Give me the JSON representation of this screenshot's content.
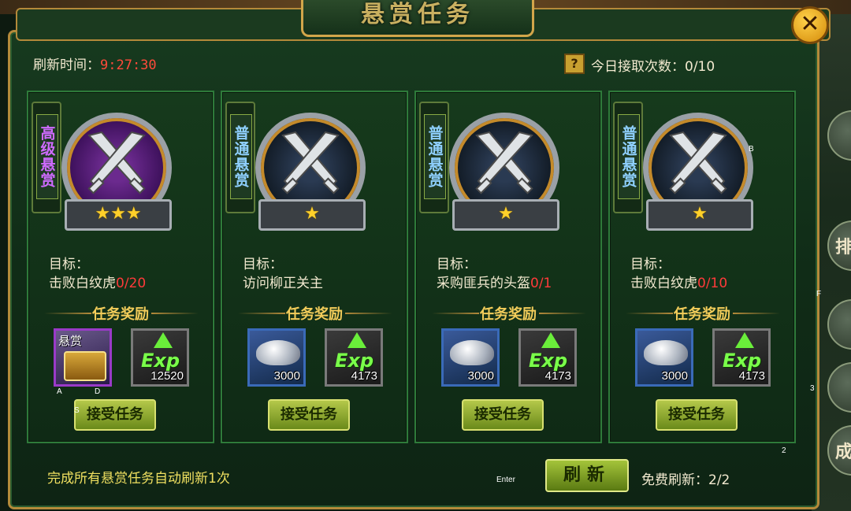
{
  "title": "悬赏任务",
  "refresh": {
    "label": "刷新时间：",
    "time": "9:27:30"
  },
  "daily": {
    "label": "今日接取次数：0/10",
    "help": "?"
  },
  "reward_title": "任务奖励",
  "goal_label": "目标：",
  "accept_label": "接受任务",
  "cards": [
    {
      "tag": "高级悬赏",
      "tier": "high",
      "stars": "★★★",
      "goal_text": "击败白纹虎",
      "goal_progress": "0/20",
      "reward1": {
        "icon": "treasure-chest-icon",
        "label": "悬赏",
        "count": ""
      },
      "reward2": {
        "icon": "exp-icon",
        "text": "Exp",
        "count": "12520"
      }
    },
    {
      "tag": "普通悬赏",
      "tier": "normal",
      "stars": "★",
      "goal_text": "访问柳正关主",
      "goal_progress": "",
      "reward1": {
        "icon": "silver-ingot-icon",
        "label": "",
        "count": "3000"
      },
      "reward2": {
        "icon": "exp-icon",
        "text": "Exp",
        "count": "4173"
      }
    },
    {
      "tag": "普通悬赏",
      "tier": "normal",
      "stars": "★",
      "goal_text": "采购匪兵的头盔",
      "goal_progress": "0/1",
      "reward1": {
        "icon": "silver-ingot-icon",
        "label": "",
        "count": "3000"
      },
      "reward2": {
        "icon": "exp-icon",
        "text": "Exp",
        "count": "4173"
      }
    },
    {
      "tag": "普通悬赏",
      "tier": "normal",
      "stars": "★",
      "goal_text": "击败白纹虎",
      "goal_progress": "0/10",
      "reward1": {
        "icon": "silver-ingot-icon",
        "label": "",
        "count": "3000"
      },
      "reward2": {
        "icon": "exp-icon",
        "text": "Exp",
        "count": "4173"
      }
    }
  ],
  "footer": {
    "note": "完成所有悬赏任务自动刷新1次",
    "refresh_button": "刷新",
    "free_refresh": "免费刷新：2/2"
  },
  "side_texts": {
    "s1": "排",
    "s2": "成"
  },
  "key_hints": {
    "a": "A",
    "d": "D",
    "s": "S",
    "b": "B",
    "f": "F",
    "three": "3",
    "two": "2",
    "enter": "Enter"
  },
  "colors": {
    "gold": "#d2a64a",
    "red_progress": "#ff3a3a",
    "high_tag": "#cf6bff",
    "normal_tag": "#8fd0ff"
  }
}
